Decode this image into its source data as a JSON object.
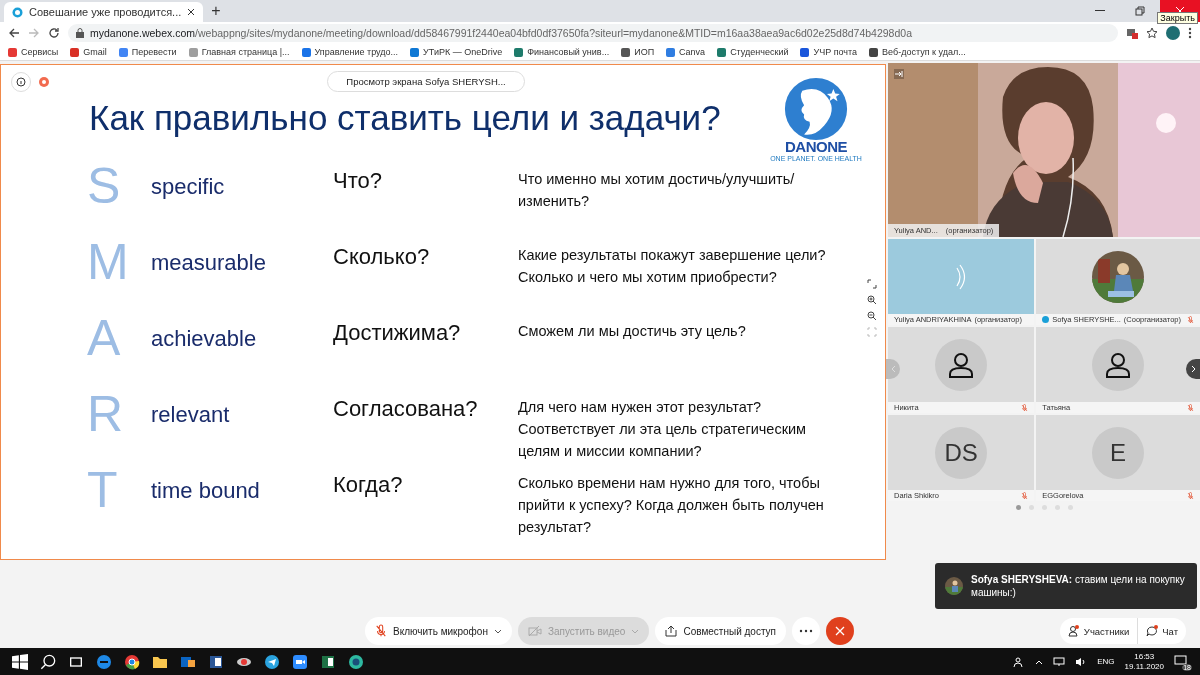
{
  "browser": {
    "tab_title": "Совешание уже проводится...",
    "new_tab": "+",
    "url_host": "mydanone.webex.com",
    "url_path": "/webappng/sites/mydanone/meeting/download/dd58467991f2440ea04bfd0df37650fa?siteurl=mydanone&MTID=m16aa38aea9ac6d02e25d8d74b4298d0a",
    "tooltip": "Закрыть",
    "bookmarks": [
      {
        "label": "Сервисы",
        "color": "#e53935"
      },
      {
        "label": "Gmail",
        "color": "#d93025"
      },
      {
        "label": "Перевести",
        "color": "#4285f4"
      },
      {
        "label": "Главная страница |...",
        "color": "#9e9e9e"
      },
      {
        "label": "Управление трудо...",
        "color": "#1a73e8"
      },
      {
        "label": "УТиРК — OneDrive",
        "color": "#0f78d4"
      },
      {
        "label": "Финансовый унив...",
        "color": "#1e7b6b"
      },
      {
        "label": "ИОП",
        "color": "#555555"
      },
      {
        "label": "Canva",
        "color": "#2f7de1"
      },
      {
        "label": "Студенческий",
        "color": "#1e7b6b"
      },
      {
        "label": "УЧР почта",
        "color": "#1a56db"
      },
      {
        "label": "Веб-доступ к удал...",
        "color": "#444444"
      }
    ]
  },
  "share_banner": {
    "label": "Просмотр экрана",
    "name": "Sofya SHERYSH..."
  },
  "slide": {
    "title": "Как правильно ставить цели и задачи?",
    "logo": "DANONE",
    "tagline": "ONE PLANET. ONE HEALTH",
    "rows": [
      {
        "letter": "S",
        "word": "specific",
        "question": "Что?",
        "answer": "Что именно мы хотим достичь/улучшить/изменить?"
      },
      {
        "letter": "M",
        "word": "measurable",
        "question": "Сколько?",
        "answer": "Какие результаты покажут завершение цели? Сколько и чего мы хотим приобрести?"
      },
      {
        "letter": "A",
        "word": "achievable",
        "question": "Достижима?",
        "answer": "Сможем ли мы достичь эту цель?"
      },
      {
        "letter": "R",
        "word": "relevant",
        "question": "Согласована?",
        "answer": "Для чего нам нужен этот результат? Соответствует ли эта цель стратегическим целям и миссии компании?"
      },
      {
        "letter": "T",
        "word": "time bound",
        "question": "Когда?",
        "answer": "Сколько времени нам нужно для того, чтобы прийти к успеху? Когда должен быть получен результат?"
      }
    ]
  },
  "main_video": {
    "kind": "picture",
    "name": "Yuliya AND...",
    "role": "(организатор)"
  },
  "tiles": [
    {
      "kind": "audio",
      "name": "Yuliya ANDRIYAKHINA",
      "role": "(организатор)",
      "muted": false
    },
    {
      "name": "Sofya SHERYSHE...",
      "role": "(Соорганизатор)",
      "muted": true
    },
    {
      "kind": "avatar",
      "name": "Никита",
      "muted": true
    },
    {
      "kind": "avatar",
      "name": "Татьяна",
      "muted": true
    },
    {
      "kind": "initials",
      "initials": "DS",
      "name": "Daria Shkikro",
      "muted": true
    },
    {
      "kind": "initials",
      "initials": "E",
      "name": "EGGorelova",
      "muted": true
    }
  ],
  "pages": [
    {
      "selected": true
    },
    {
      "selected": false
    },
    {
      "selected": false
    },
    {
      "selected": false
    },
    {
      "selected": false
    }
  ],
  "chat_toast": {
    "sender": "Sofya SHERYSHEVA:",
    "message": "ставим цели на покупку машины:)"
  },
  "controls": [
    {
      "kind": "mic",
      "label": "Включить микрофон",
      "disabled": false
    },
    {
      "kind": "video",
      "label": "Запустить видео",
      "disabled": true
    },
    {
      "kind": "share",
      "label": "Совместный доступ",
      "disabled": false
    },
    {
      "kind": "more"
    },
    {
      "kind": "leave"
    }
  ],
  "side_buttons": [
    {
      "kind": "participants",
      "label": "Участники"
    },
    {
      "kind": "chat",
      "label": "Чат"
    }
  ],
  "taskbar": {
    "language": "ENG",
    "time": "16:53",
    "date": "19.11.2020",
    "notifications": "18"
  }
}
